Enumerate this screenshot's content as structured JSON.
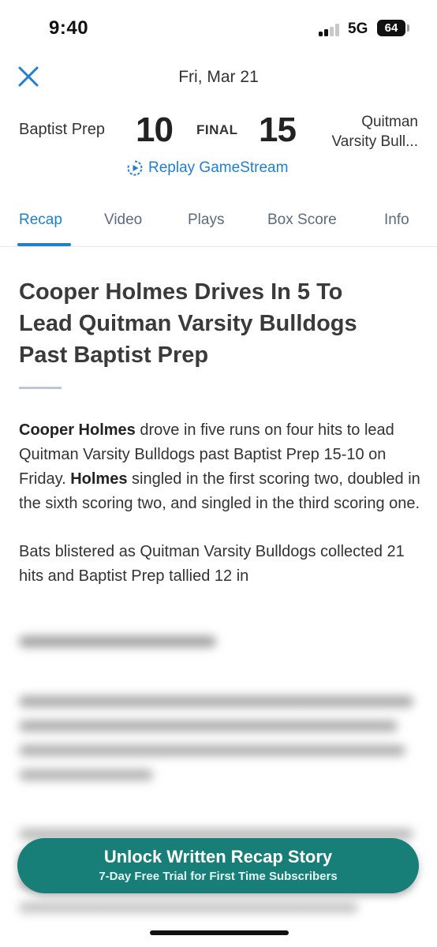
{
  "status_bar": {
    "time": "9:40",
    "network": "5G",
    "battery": "64",
    "icons": [
      "signal-bars-icon",
      "battery-icon"
    ]
  },
  "header": {
    "close_icon": "close-icon",
    "date": "Fri, Mar 21"
  },
  "scoreboard": {
    "home_team": "Baptist Prep",
    "home_score": "10",
    "status": "FINAL",
    "away_score": "15",
    "away_team_line1": "Quitman",
    "away_team_line2": "Varsity Bull..."
  },
  "replay": {
    "label": "Replay GameStream",
    "icon": "replay-icon",
    "color": "#1f7fd0"
  },
  "tabs": [
    {
      "label": "Recap",
      "active": true
    },
    {
      "label": "Video",
      "active": false
    },
    {
      "label": "Plays",
      "active": false
    },
    {
      "label": "Box Score",
      "active": false
    },
    {
      "label": "Info",
      "active": false
    }
  ],
  "article": {
    "headline_line1": "Cooper Holmes Drives In 5 To",
    "headline_line2": "Lead Quitman Varsity Bulldogs",
    "headline_line3": "Past Baptist Prep",
    "p1_name": "Cooper Holmes",
    "p1_text_a": " drove in five runs on four hits to lead Quitman Varsity Bulldogs past Baptist Prep 15-10 on Friday. ",
    "p1_name2": "Holmes",
    "p1_text_b": " singled in the first scoring two, doubled in the sixth scoring two, and singled in the third scoring one.",
    "p2_text": "Bats blistered as Quitman Varsity Bulldogs collected 21 hits and Baptist Prep tallied 12 in"
  },
  "unlock": {
    "title": "Unlock Written Recap Story",
    "subtitle": "7-Day Free Trial for First Time Subscribers",
    "color": "#177f78"
  }
}
